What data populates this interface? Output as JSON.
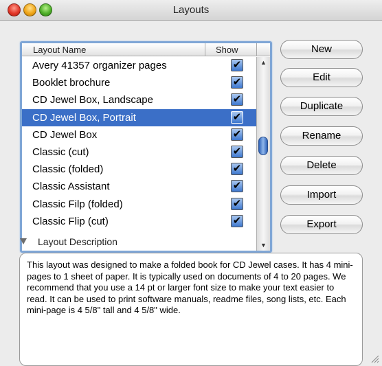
{
  "window": {
    "title": "Layouts"
  },
  "list": {
    "columns": {
      "name": "Layout Name",
      "show": "Show"
    },
    "rows": [
      {
        "name": "Avery 41357 organizer pages",
        "show": true,
        "selected": false
      },
      {
        "name": "Booklet brochure",
        "show": true,
        "selected": false
      },
      {
        "name": "CD Jewel Box, Landscape",
        "show": true,
        "selected": false
      },
      {
        "name": "CD Jewel Box, Portrait",
        "show": true,
        "selected": true
      },
      {
        "name": "CD Jewel Box",
        "show": true,
        "selected": false
      },
      {
        "name": "Classic (cut)",
        "show": true,
        "selected": false
      },
      {
        "name": "Classic (folded)",
        "show": true,
        "selected": false
      },
      {
        "name": "Classic Assistant",
        "show": true,
        "selected": false
      },
      {
        "name": "Classic Filp (folded)",
        "show": true,
        "selected": false
      },
      {
        "name": "Classic Flip (cut)",
        "show": true,
        "selected": false
      }
    ],
    "scroll_position": 0.45
  },
  "buttons": {
    "new": "New",
    "edit": "Edit",
    "duplicate": "Duplicate",
    "rename": "Rename",
    "delete": "Delete",
    "import": "Import",
    "export": "Export"
  },
  "description": {
    "label": "Layout Description",
    "expanded": true,
    "text": "This layout was designed to make a folded book for CD Jewel cases.  It has  4 mini-pages to 1 sheet of paper. It is typically used on documents of 4 to 20 pages.  We recommend that you use a 14 pt or larger font size to make your text easier to read.  It can be used to print software manuals, readme files, song lists, etc.  Each mini-page is 4 5/8\" tall and 4 5/8\"  wide."
  },
  "colors": {
    "selection": "#3b6fc7",
    "focus_ring": "#7fa6d6"
  }
}
